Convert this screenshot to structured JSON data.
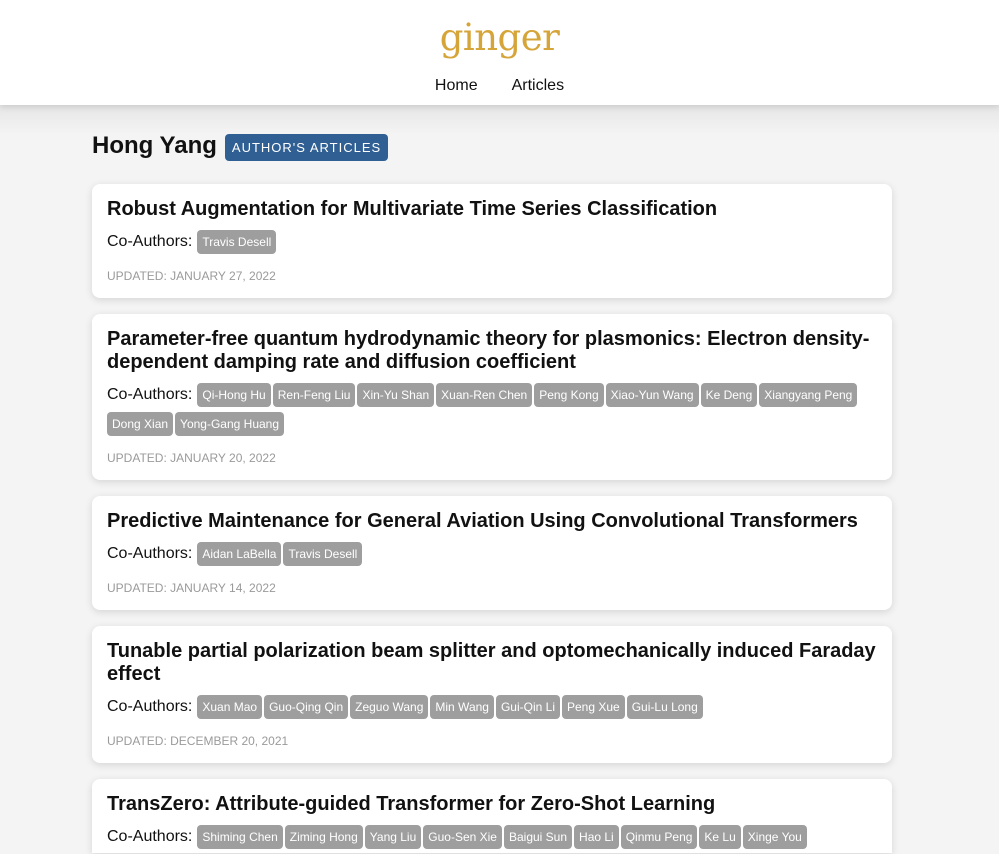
{
  "site": {
    "logo": "ginger",
    "nav": [
      {
        "label": "Home"
      },
      {
        "label": "Articles"
      }
    ],
    "logo_color": "#d6a53a"
  },
  "author": {
    "name": "Hong Yang",
    "badge": "AUTHOR'S ARTICLES",
    "badge_color": "#2f5f93"
  },
  "co_label": "Co-Authors:",
  "articles": [
    {
      "title": "Robust Augmentation for Multivariate Time Series Classification",
      "coauthors": [
        "Travis Desell"
      ],
      "updated": "UPDATED: JANUARY 27, 2022"
    },
    {
      "title": "Parameter-free quantum hydrodynamic theory for plasmonics: Electron density-dependent damping rate and diffusion coefficient",
      "coauthors": [
        "Qi-Hong Hu",
        "Ren-Feng Liu",
        "Xin-Yu Shan",
        "Xuan-Ren Chen",
        "Peng Kong",
        "Xiao-Yun Wang",
        "Ke Deng",
        "Xiangyang Peng",
        "Dong Xian",
        "Yong-Gang Huang"
      ],
      "updated": "UPDATED: JANUARY 20, 2022"
    },
    {
      "title": "Predictive Maintenance for General Aviation Using Convolutional Transformers",
      "coauthors": [
        "Aidan LaBella",
        "Travis Desell"
      ],
      "updated": "UPDATED: JANUARY 14, 2022"
    },
    {
      "title": "Tunable partial polarization beam splitter and optomechanically induced Faraday effect",
      "coauthors": [
        "Xuan Mao",
        "Guo-Qing Qin",
        "Zeguo Wang",
        "Min Wang",
        "Gui-Qin Li",
        "Peng Xue",
        "Gui-Lu Long"
      ],
      "updated": "UPDATED: DECEMBER 20, 2021"
    },
    {
      "title": "TransZero: Attribute-guided Transformer for Zero-Shot Learning",
      "coauthors": [
        "Shiming Chen",
        "Ziming Hong",
        "Yang Liu",
        "Guo-Sen Xie",
        "Baigui Sun",
        "Hao Li",
        "Qinmu Peng",
        "Ke Lu",
        "Xinge You"
      ],
      "updated": ""
    }
  ]
}
